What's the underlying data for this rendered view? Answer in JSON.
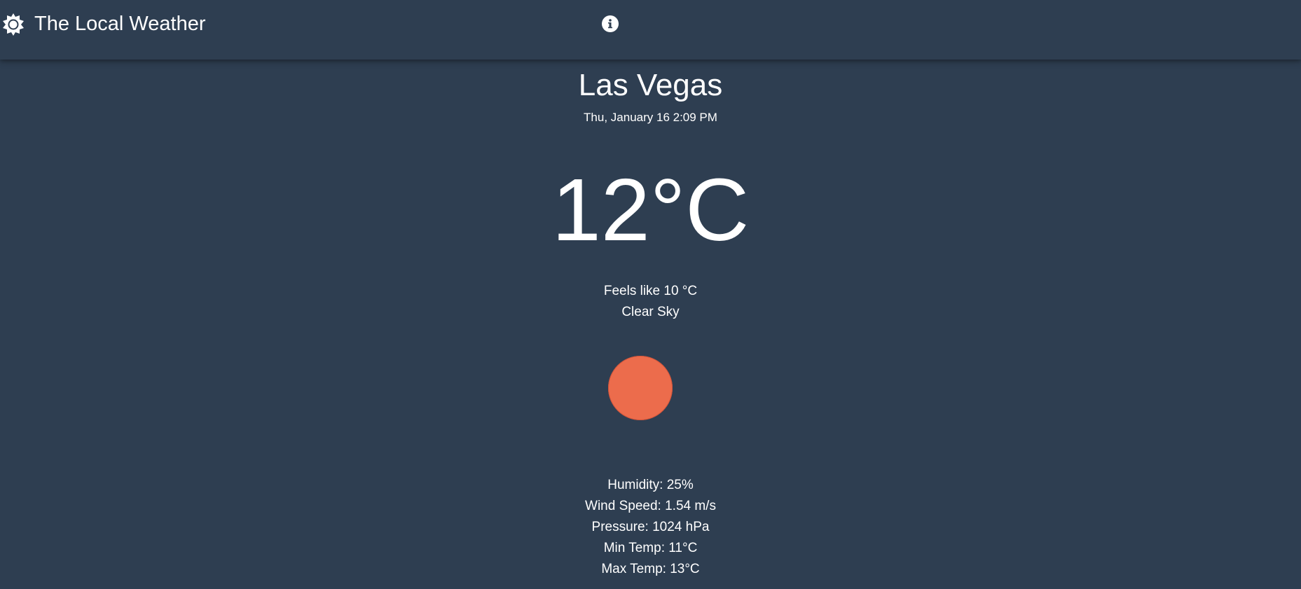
{
  "app": {
    "title": "The Local Weather",
    "logo_icon": "sun-gear-icon",
    "info_icon": "info-icon"
  },
  "weather": {
    "city": "Las Vegas",
    "datetime": "Thu, January 16 2:09 PM",
    "temperature": "12°C",
    "feels_like": "Feels like 10 °C",
    "description": "Clear Sky",
    "condition_icon": "clear-sky-sun-icon",
    "condition_color": "#ec6c4c"
  },
  "stats": [
    {
      "label": "Humidity: 25%"
    },
    {
      "label": "Wind Speed: 1.54 m/s"
    },
    {
      "label": "Pressure: 1024 hPa"
    },
    {
      "label": "Min Temp: 11°C"
    },
    {
      "label": "Max Temp: 13°C"
    }
  ],
  "colors": {
    "background": "#2e3e51",
    "text": "#ffffff",
    "accent": "#ec6c4c"
  }
}
